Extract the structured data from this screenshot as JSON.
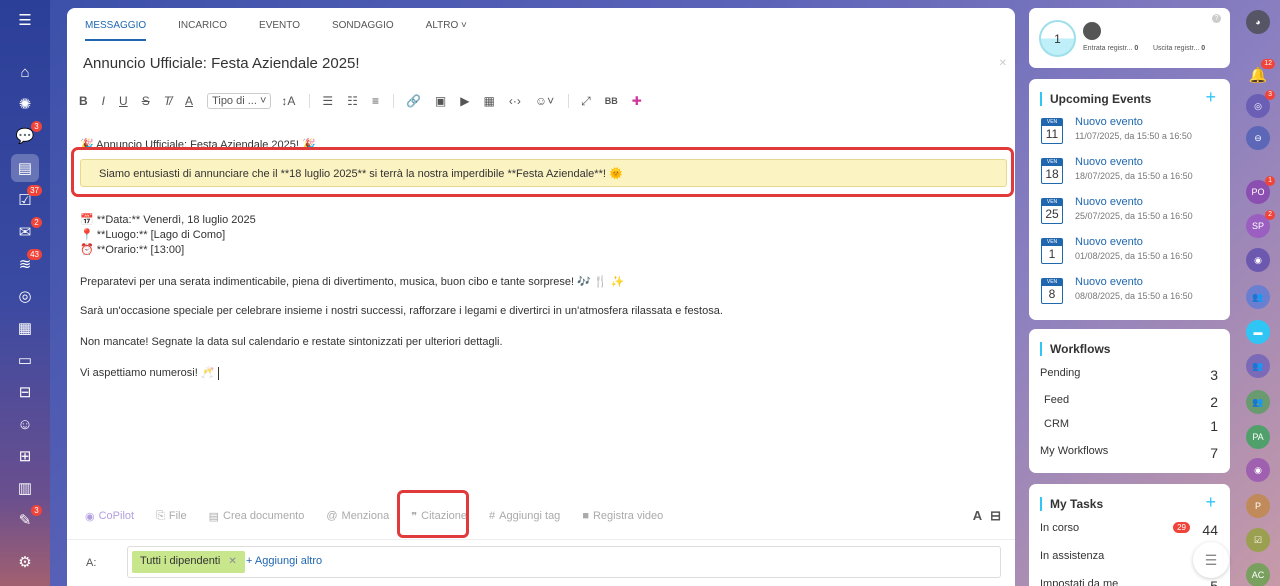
{
  "tabs": [
    "MESSAGGIO",
    "INCARICO",
    "EVENTO",
    "SONDAGGIO",
    "ALTRO ˅"
  ],
  "post": {
    "title": "Annuncio Ufficiale: Festa Aziendale 2025!",
    "style_select": "Tipo di ...",
    "heading_line": "🎉 Annuncio Ufficiale: Festa Aziendale 2025! 🎉",
    "quote": "Siamo entusiasti di annunciare che il **18 luglio 2025** si terrà la nostra imperdibile **Festa Aziendale**! 🌞",
    "data_line": "📅 **Data:** Venerdì, 18 luglio 2025",
    "luogo_line": "📍 **Luogo:** [Lago di Como]",
    "orario_line": "⏰ **Orario:** [13:00]",
    "para1": "Preparatevi per una serata indimenticabile, piena di divertimento, musica, buon cibo e tante sorprese! 🎶 🍴 ✨",
    "para2": "Sarà un'occasione speciale per celebrare insieme i nostri successi, rafforzare i legami e divertirci in un'atmosfera rilassata e festosa.",
    "para3": "Non mancate! Segnate la data sul calendario e restate sintonizzati per ulteriori dettagli.",
    "para4": "Vi aspettiamo numerosi! 🥂"
  },
  "actions": {
    "copilot": "CoPilot",
    "file": "File",
    "doc": "Crea documento",
    "mention": "Menziona",
    "quote": "Citazione",
    "tag": "Aggiungi tag",
    "video": "Registra video"
  },
  "recipients": {
    "label": "A:",
    "chip": "Tutti i dipendenti",
    "add_more": "+ Aggiungi altro"
  },
  "timeman": {
    "count": "1",
    "entrata": "Entrata registr...",
    "entrata_v": "0",
    "uscita": "Uscita registr...",
    "uscita_v": "0"
  },
  "events": {
    "title": "Upcoming Events",
    "items": [
      {
        "day": "VEN",
        "num": "11",
        "name": "Nuovo evento",
        "time": "11/07/2025, da 15:50 a 16:50"
      },
      {
        "day": "VEN",
        "num": "18",
        "name": "Nuovo evento",
        "time": "18/07/2025, da 15:50 a 16:50"
      },
      {
        "day": "VEN",
        "num": "25",
        "name": "Nuovo evento",
        "time": "25/07/2025, da 15:50 a 16:50"
      },
      {
        "day": "VEN",
        "num": "1",
        "name": "Nuovo evento",
        "time": "01/08/2025, da 15:50 a 16:50"
      },
      {
        "day": "VEN",
        "num": "8",
        "name": "Nuovo evento",
        "time": "08/08/2025, da 15:50 a 16:50"
      }
    ]
  },
  "workflows": {
    "title": "Workflows",
    "pending": "Pending",
    "pending_v": "3",
    "feed": "Feed",
    "feed_v": "2",
    "crm": "CRM",
    "crm_v": "1",
    "mine": "My Workflows",
    "mine_v": "7"
  },
  "tasks": {
    "title": "My Tasks",
    "in_progress": "In corso",
    "in_progress_badge": "29",
    "in_progress_v": "44",
    "assist": "In assistenza",
    "set_by_me": "Impostati da me",
    "set_by_me_v": "5"
  },
  "left_badges": {
    "feed": "3",
    "tasks": "37",
    "mail": "2",
    "tele": "43",
    "sign": "3"
  },
  "right_badges": {
    "bell": "12",
    "pulse": "3",
    "po": "1",
    "sp": "2"
  },
  "right_avatars": {
    "po": "PO",
    "sp": "SP",
    "pa": "PA",
    "p": "P",
    "ac": "AC"
  },
  "colors": {
    "accent": "#2067b0",
    "highlight": "#e03a3a",
    "quote_bg": "#fcf3c2",
    "chip": "#c8e68c"
  }
}
